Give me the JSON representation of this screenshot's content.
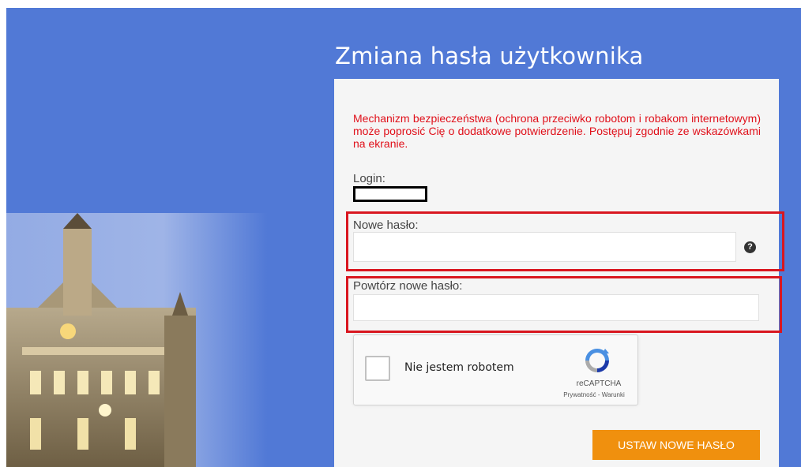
{
  "page": {
    "title": "Zmiana hasła użytkownika"
  },
  "form": {
    "warning": "Mechanizm bezpieczeństwa (ochrona przeciwko robotom i robakom internetowym) może poprosić Cię o dodatkowe potwierdzenie. Postępuj zgodnie ze wskazówkami na ekranie.",
    "login_label": "Login:",
    "new_password_label": "Nowe hasło:",
    "new_password_value": "",
    "repeat_password_label": "Powtórz nowe hasło:",
    "repeat_password_value": "",
    "help_icon": "?",
    "submit_label": "USTAW NOWE HASŁO"
  },
  "captcha": {
    "checkbox_label": "Nie jestem robotem",
    "brand": "reCAPTCHA",
    "links": "Prywatność - Warunki"
  },
  "colors": {
    "background": "#5179d6",
    "warning": "#e0101a",
    "highlight": "#d9161f",
    "submit": "#f0900e"
  }
}
